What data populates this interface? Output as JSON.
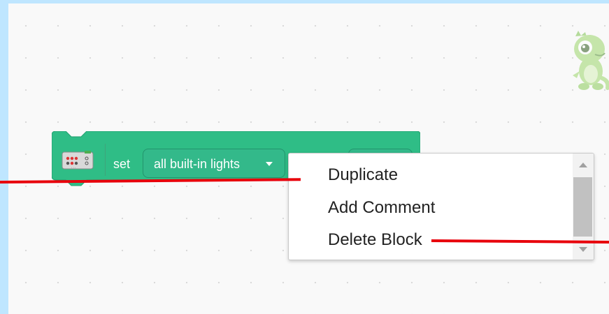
{
  "app": {
    "workspace_name": "blocks-workspace"
  },
  "block": {
    "set_label": "set",
    "lights_dropdown": "all built-in lights",
    "icon": "board-led-icon",
    "color": "#2fbd86"
  },
  "context_menu": {
    "items": [
      {
        "label": "Duplicate"
      },
      {
        "label": "Add Comment"
      },
      {
        "label": "Delete Block"
      }
    ]
  },
  "annotations": {
    "color": "#e8000b"
  },
  "mascot": {
    "icon": "dinosaur-mascot-icon"
  }
}
